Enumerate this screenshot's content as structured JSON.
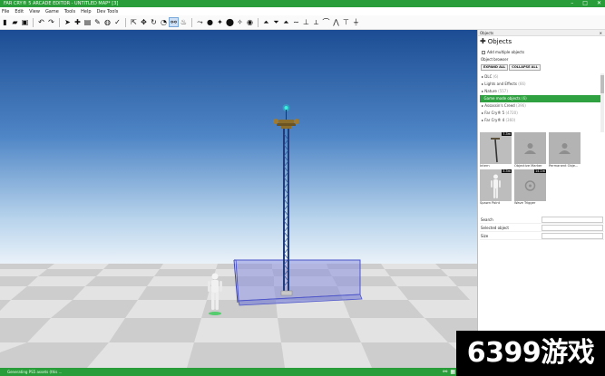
{
  "window": {
    "title": "FAR CRY® 5 ARCADE EDITOR - UNTITLED MAP* [3]",
    "controls": [
      "–",
      "□",
      "✕"
    ]
  },
  "menu": {
    "items": [
      "File",
      "Edit",
      "View",
      "Game",
      "Tools",
      "Help",
      "Dev Tools"
    ]
  },
  "toolbar": {
    "icons": [
      "new-file-icon",
      "open-folder-icon",
      "save-icon",
      "undo-icon",
      "redo-icon",
      "select-icon",
      "add-object-icon",
      "clipboard-icon",
      "wrench-icon",
      "compass-icon",
      "check-icon",
      "select-drag-icon",
      "move-icon",
      "rotate-icon",
      "scale-icon",
      "snap-icon",
      "pivot-icon",
      "path-icon",
      "terrain-paint-icon",
      "terrain-raise-icon",
      "terrain-lower-icon",
      "terrain-smooth-icon",
      "terrain-flatten-icon",
      "terrain-noise-icon",
      "brush-icon",
      "water-icon",
      "level-icon",
      "height-icon",
      "shape-icon",
      "road-icon"
    ]
  },
  "panel": {
    "header": "Objects",
    "title": "Objects",
    "add_multiple": "Add multiple objects",
    "browser_label": "Object browser",
    "expand_all": "EXPAND ALL",
    "collapse_all": "COLLAPSE ALL",
    "tree": [
      {
        "label": "DLC",
        "count": "(6)",
        "selected": false
      },
      {
        "label": "Lights and Effects",
        "count": "(66)",
        "selected": false
      },
      {
        "label": "Nature",
        "count": "(557)",
        "selected": false
      },
      {
        "label": "Game mode objects",
        "count": "(6)",
        "selected": true
      },
      {
        "label": "Assassin's Creed",
        "count": "(396)",
        "selected": false
      },
      {
        "label": "Far Cry® 5",
        "count": "(4720)",
        "selected": false
      },
      {
        "label": "Far Cry® 4",
        "count": "(360)",
        "selected": false
      }
    ],
    "thumbnails": [
      {
        "label": "Intern",
        "badge": "7.3m",
        "kind": "tower"
      },
      {
        "label": "Objective Marker",
        "badge": "",
        "kind": "placeholder"
      },
      {
        "label": "Permanent Obje...",
        "badge": "",
        "kind": "placeholder"
      },
      {
        "label": "Spawn Point",
        "badge": "3.3m",
        "kind": "person"
      },
      {
        "label": "Wave Trigger",
        "badge": "14.1m",
        "kind": "placeholder-circle"
      }
    ],
    "props": [
      {
        "label": "Search",
        "value": ""
      },
      {
        "label": "Selected object",
        "value": ""
      },
      {
        "label": "Size",
        "value": ""
      }
    ]
  },
  "status": {
    "text": "Generating PS5 assets (this ..."
  },
  "watermark": "6399游戏",
  "colors": {
    "accent": "#2a9d3b",
    "selection": "#2fa140",
    "sky_top": "#1d4f96",
    "sky_horizon": "#e7f0f8",
    "floor_light": "#eeeeee",
    "floor_dark": "#c7c7c7",
    "trigger_box": "#5a66d6"
  }
}
